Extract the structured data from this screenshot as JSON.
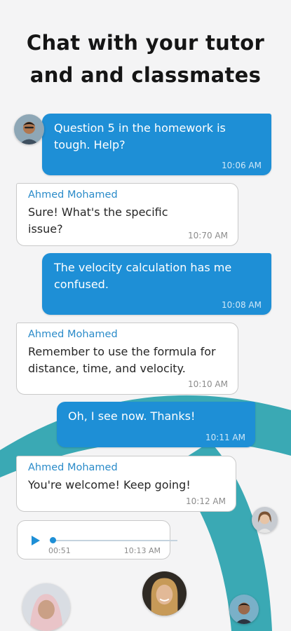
{
  "headline": {
    "line1": "Chat with your tutor",
    "line2": "and and classmates"
  },
  "theme": {
    "accent": "#1e8fd6",
    "arc": "#3aa9b4",
    "sender_name_color": "#2a8bc9",
    "background": "#f4f4f5"
  },
  "messages": [
    {
      "direction": "outgoing",
      "text": "Question 5 in the homework is tough. Help?",
      "time": "10:06 AM"
    },
    {
      "direction": "incoming",
      "sender": "Ahmed Mohamed",
      "text": "Sure! What's the specific issue?",
      "time": "10:70 AM"
    },
    {
      "direction": "outgoing",
      "text": "The velocity calculation has me confused.",
      "time": "10:08 AM"
    },
    {
      "direction": "incoming",
      "sender": "Ahmed Mohamed",
      "text": "Remember to use the formula for distance, time, and velocity.",
      "time": "10:10 AM"
    },
    {
      "direction": "outgoing",
      "text": "Oh, I see now. Thanks!",
      "time": "10:11 AM"
    },
    {
      "direction": "incoming",
      "sender": "Ahmed Mohamed",
      "text": "You're welcome! Keep going!",
      "time": "10:12 AM"
    }
  ],
  "voice_message": {
    "position": "00:51",
    "time": "10:13 AM",
    "icon": "play-icon"
  }
}
